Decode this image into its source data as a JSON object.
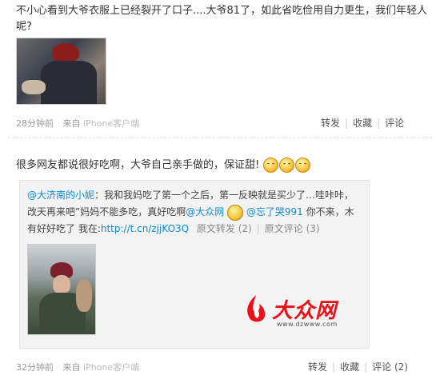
{
  "post1": {
    "text": "不小心看到大爷衣服上已经裂开了口子....大爷81了，如此省吃俭用自力更生，我们年轻人呢?",
    "time": "28分钟前",
    "from": "来自",
    "source": "iPhone客户端",
    "actions": {
      "forward": "转发",
      "favorite": "收藏",
      "comment": "评论"
    }
  },
  "post2": {
    "text": "很多网友都说很好吃啊，大爷自己亲手做的，保证甜!",
    "smileys": [
      "smiley-icon",
      "smiley-icon",
      "smiley-icon"
    ],
    "repost": {
      "user": "@大济南的小妮",
      "text_a": "我和我妈吃了第一个之后，第一反映就是买少了…哇咔咔，改天再来吧”妈妈不能多吃，真好吃啊",
      "mention_1": "@大众网",
      "mention_2": "@忘了哭991",
      "text_b": "你不来，木有好好吃了 我在:",
      "link": "http://t.cn/zjjKO3Q",
      "orig_forward": "原文转发 (2)",
      "orig_comment": "原文评论 (3)"
    },
    "time": "32分钟前",
    "from": "来自",
    "source": "iPhone客户端",
    "actions": {
      "forward": "转发",
      "favorite": "收藏",
      "comment": "评论 (2)"
    }
  },
  "watermark": {
    "brand": "大众网",
    "url": "www.dzwww.com"
  },
  "colors": {
    "link": "#0a8cd2",
    "watermark": "#e8131a",
    "repost_bg": "#f3f3f3"
  }
}
